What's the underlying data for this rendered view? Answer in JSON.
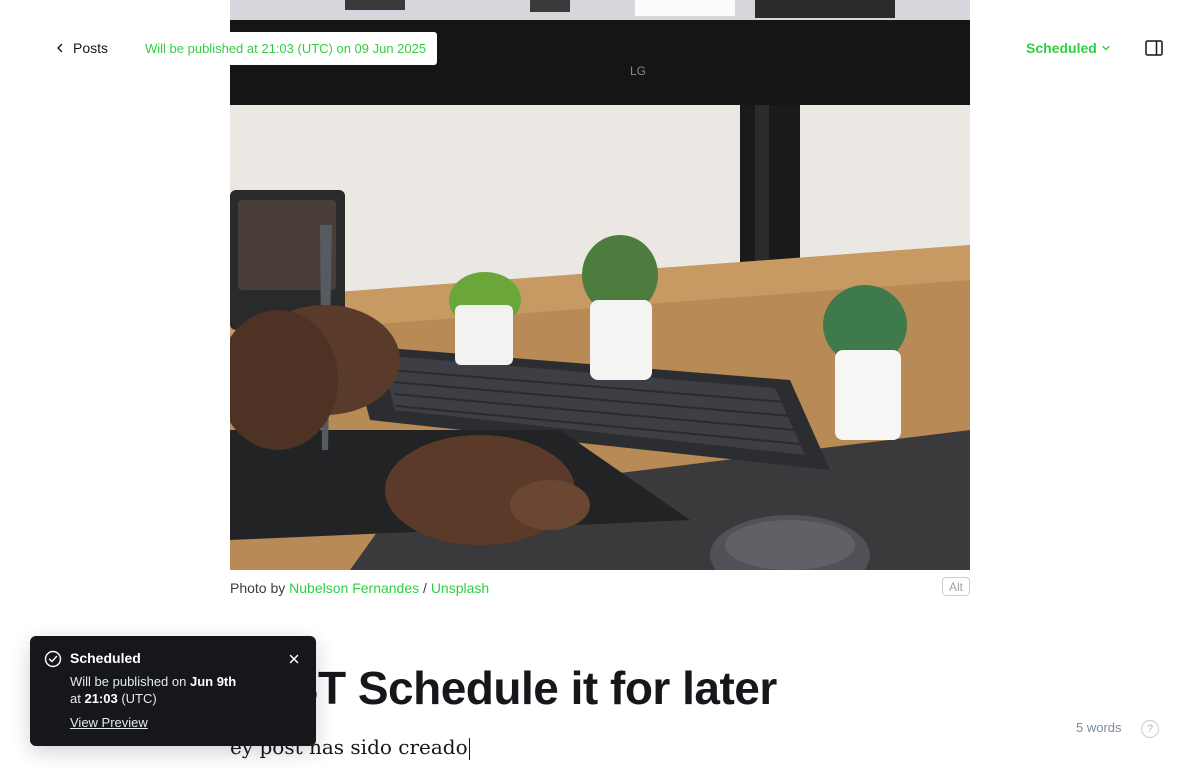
{
  "header": {
    "back_label": "Posts",
    "publish_notice": "Will be published at 21:03 (UTC) on 09 Jun 2025",
    "status_label": "Scheduled"
  },
  "feature_image": {
    "caption_prefix": "Photo by ",
    "author": "Nubelson Fernandes",
    "separator": " / ",
    "source": "Unsplash",
    "alt_label": "Alt"
  },
  "post": {
    "title": "TEST Schedule it for later",
    "body": "ey post has sido creado"
  },
  "footer": {
    "word_count": "5 words",
    "help_label": "?"
  },
  "toast": {
    "title": "Scheduled",
    "line1_prefix": "Will be published on ",
    "line1_date": "Jun 9th",
    "line2_prefix": "at ",
    "line2_time": "21:03",
    "line2_suffix": " (UTC)",
    "link_label": "View Preview",
    "close_label": "×"
  },
  "colors": {
    "accent_green": "#30cf43",
    "toast_bg": "#15171a",
    "text_dark": "#15171a"
  },
  "icons": [
    "chevron-left-icon",
    "chevron-down-icon",
    "sidebar-toggle-icon",
    "check-circle-icon",
    "close-icon",
    "help-icon"
  ]
}
